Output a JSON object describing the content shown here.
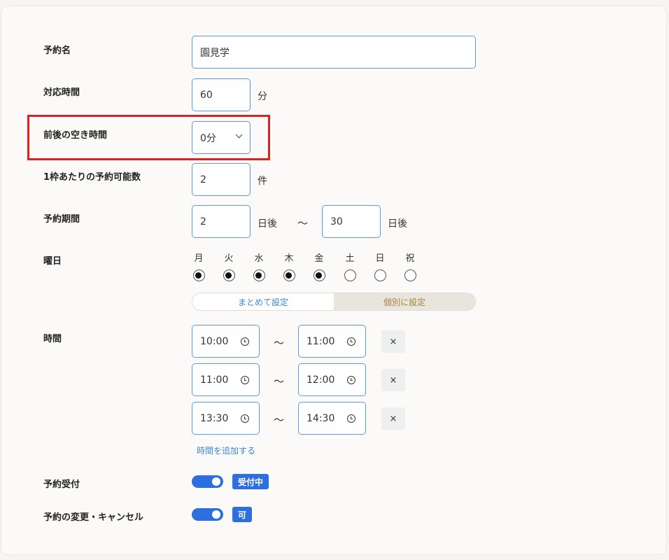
{
  "form": {
    "reservation_name": {
      "label": "予約名",
      "value": "園見学"
    },
    "duration": {
      "label": "対応時間",
      "value": "60",
      "unit": "分"
    },
    "buffer": {
      "label": "前後の空き時間",
      "value": "0分"
    },
    "capacity": {
      "label": "1枠あたりの予約可能数",
      "value": "2",
      "unit": "件"
    },
    "period": {
      "label": "予約期間",
      "start": "2",
      "start_unit": "日後",
      "tilde": "〜",
      "end": "30",
      "end_unit": "日後"
    },
    "weekdays": {
      "label": "曜日",
      "days": [
        {
          "label": "月",
          "checked": true
        },
        {
          "label": "火",
          "checked": true
        },
        {
          "label": "水",
          "checked": true
        },
        {
          "label": "木",
          "checked": true
        },
        {
          "label": "金",
          "checked": true
        },
        {
          "label": "土",
          "checked": false
        },
        {
          "label": "日",
          "checked": false
        },
        {
          "label": "祝",
          "checked": false
        }
      ],
      "segment": {
        "left": "まとめて設定",
        "right": "個別に設定",
        "selected": "right"
      }
    },
    "times": {
      "label": "時間",
      "tilde": "〜",
      "remove": "×",
      "rows": [
        {
          "start": "10:00",
          "end": "11:00"
        },
        {
          "start": "11:00",
          "end": "12:00"
        },
        {
          "start": "13:30",
          "end": "14:30"
        }
      ],
      "add_link": "時間を追加する"
    },
    "accepting": {
      "label": "予約受付",
      "on": true,
      "badge": "受付中"
    },
    "changes": {
      "label": "予約の変更・キャンセル",
      "on": true,
      "badge": "可"
    }
  },
  "colors": {
    "accent": "#2d6fe0",
    "input_border": "#5b9be6",
    "highlight": "#dc2323",
    "segment_selected_text": "#a7823a"
  }
}
